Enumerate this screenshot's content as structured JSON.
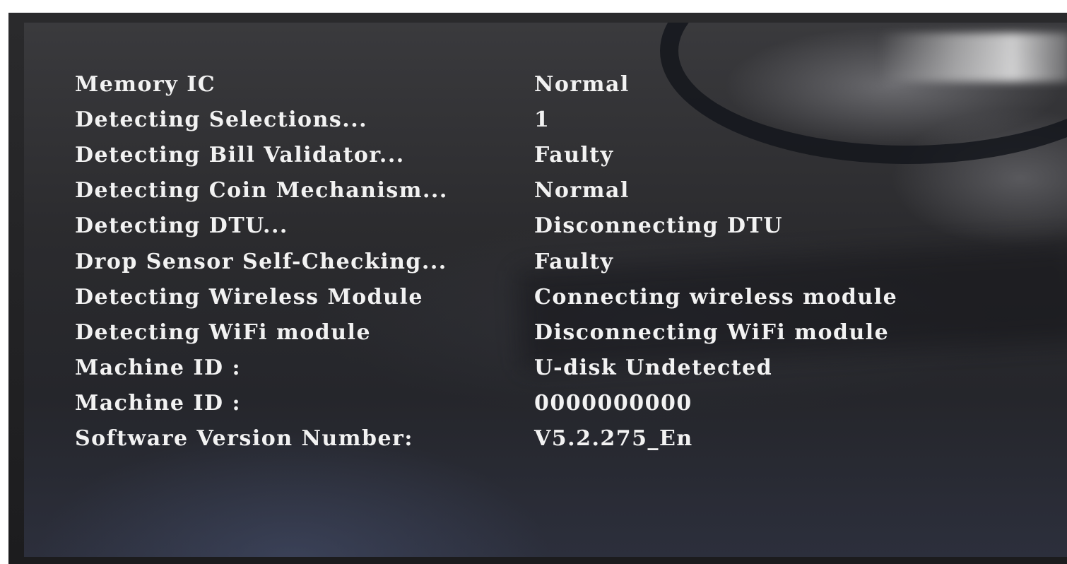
{
  "diagnostics": {
    "rows": [
      {
        "label": "Memory IC",
        "value": "Normal"
      },
      {
        "label": "Detecting Selections...",
        "value": "1"
      },
      {
        "label": "Detecting Bill Validator...",
        "value": "Faulty"
      },
      {
        "label": "Detecting Coin Mechanism...",
        "value": "Normal"
      },
      {
        "label": "Detecting DTU...",
        "value": "Disconnecting DTU"
      },
      {
        "label": "Drop Sensor Self-Checking...",
        "value": "Faulty"
      },
      {
        "label": "Detecting Wireless Module",
        "value": "Connecting wireless module"
      },
      {
        "label": "Detecting WiFi module",
        "value": "Disconnecting WiFi module"
      },
      {
        "label": "Machine ID :",
        "value": "U-disk Undetected"
      },
      {
        "label": "Machine ID :",
        "value": "0000000000"
      },
      {
        "label": "Software Version Number:",
        "value": "V5.2.275_En"
      }
    ]
  }
}
